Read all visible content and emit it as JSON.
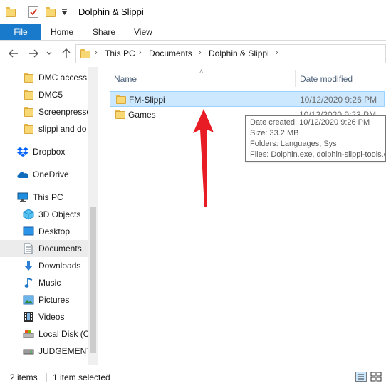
{
  "window": {
    "title": "Dolphin & Slippi"
  },
  "ribbon": {
    "tabs": [
      "File",
      "Home",
      "Share",
      "View"
    ]
  },
  "address": {
    "crumbs": [
      "This PC",
      "Documents",
      "Dolphin & Slippi"
    ]
  },
  "nav": {
    "items": [
      {
        "label": "DMC access",
        "icon": "folder-icon"
      },
      {
        "label": "DMC5",
        "icon": "folder-icon"
      },
      {
        "label": "Screenpresso",
        "icon": "folder-icon"
      },
      {
        "label": "slippi and do",
        "icon": "folder-icon"
      },
      {
        "label": "Dropbox",
        "icon": "dropbox-icon"
      },
      {
        "label": "OneDrive",
        "icon": "onedrive-icon"
      },
      {
        "label": "This PC",
        "icon": "this-pc-icon"
      },
      {
        "label": "3D Objects",
        "icon": "3d-objects-icon"
      },
      {
        "label": "Desktop",
        "icon": "desktop-icon"
      },
      {
        "label": "Documents",
        "icon": "documents-icon"
      },
      {
        "label": "Downloads",
        "icon": "downloads-icon"
      },
      {
        "label": "Music",
        "icon": "music-icon"
      },
      {
        "label": "Pictures",
        "icon": "pictures-icon"
      },
      {
        "label": "Videos",
        "icon": "videos-icon"
      },
      {
        "label": "Local Disk (C",
        "icon": "disk-icon"
      },
      {
        "label": "JUDGEMENT",
        "icon": "drive-icon"
      }
    ]
  },
  "columns": {
    "name": "Name",
    "date_modified": "Date modified"
  },
  "files": [
    {
      "name": "FM-Slippi",
      "date": "10/12/2020 9:26 PM"
    },
    {
      "name": "Games",
      "date": "10/12/2020 9:23 PM"
    }
  ],
  "tooltip": {
    "line1": "Date created: 10/12/2020 9:26 PM",
    "line2": "Size: 33.2 MB",
    "line3": "Folders: Languages, Sys",
    "line4": "Files: Dolphin.exe, dolphin-slippi-tools.exe, ..."
  },
  "status": {
    "count": "2 items",
    "selected": "1 item selected"
  },
  "colors": {
    "accent": "#1979ca",
    "selection": "#cce8ff",
    "arrow": "#e81c24"
  }
}
